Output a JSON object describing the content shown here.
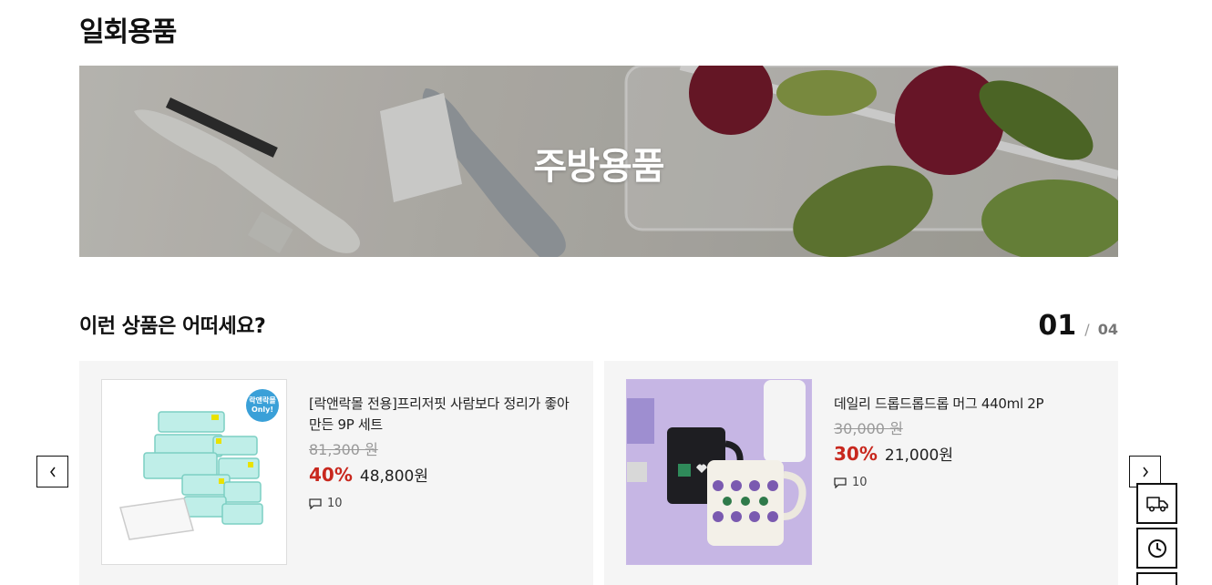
{
  "page": {
    "title": "일회용품"
  },
  "banner": {
    "title": "주방용품"
  },
  "recommend": {
    "title": "이런 상품은 어떠세요?",
    "pager": {
      "current": "01",
      "separator": "/",
      "total": "04"
    }
  },
  "products": [
    {
      "name": "[락앤락몰 전용]프리저핏 사람보다 정리가 좋아 만든 9P 세트",
      "original_price": "81,300 원",
      "discount": "40%",
      "price": "48,800원",
      "reviews": "10",
      "badge": "락앤락몰 Only!"
    },
    {
      "name": "데일리 드롭드롭드롭 머그 440ml 2P",
      "original_price": "30,000 원",
      "discount": "30%",
      "price": "21,000원",
      "reviews": "10"
    }
  ],
  "icons": {
    "prev": "chevron-left-icon",
    "next": "chevron-right-icon",
    "review": "comment-icon",
    "delivery": "truck-icon",
    "recent": "clock-icon"
  },
  "colors": {
    "discount": "#c8281e",
    "card_bg": "#f5f5f5",
    "accent": "#111111"
  }
}
